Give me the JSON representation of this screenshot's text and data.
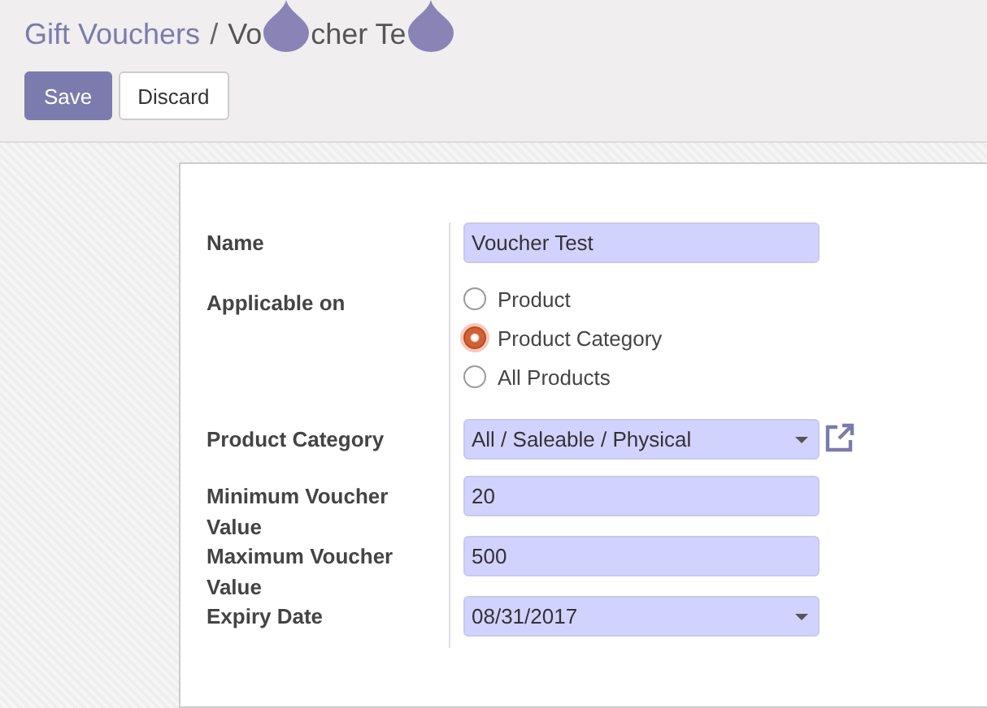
{
  "breadcrumb": {
    "parent": "Gift Vouchers",
    "separator": "/",
    "current_fragments": [
      "Vo",
      "cher Te"
    ]
  },
  "buttons": [
    {
      "label": "Save",
      "kind": "primary"
    },
    {
      "label": "Discard",
      "kind": "secondary"
    }
  ],
  "form": {
    "fields": [
      {
        "label": "Name",
        "kind": "text",
        "value": "Voucher Test"
      },
      {
        "label": "Applicable on",
        "kind": "radio",
        "options": [
          {
            "label": "Product",
            "selected": false
          },
          {
            "label": "Product Category",
            "selected": true
          },
          {
            "label": "All Products",
            "selected": false
          }
        ]
      },
      {
        "label": "Product Category",
        "kind": "select",
        "value": "All / Saleable / Physical",
        "external_link": true
      },
      {
        "label": "Minimum Voucher Value",
        "kind": "text",
        "value": "20"
      },
      {
        "label": "Maximum Voucher Value",
        "kind": "text",
        "value": "500"
      },
      {
        "label": "Expiry Date",
        "kind": "date",
        "value": "08/31/2017"
      }
    ]
  }
}
